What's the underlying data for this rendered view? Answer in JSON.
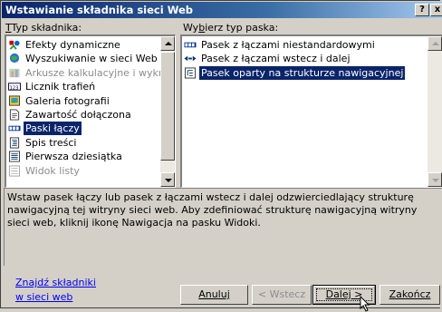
{
  "window": {
    "title": "Wstawianie składnika sieci Web",
    "help_btn": "?",
    "close_btn": "x"
  },
  "left_panel": {
    "label": "Typ składnika:",
    "items": [
      {
        "label": "Efekty dynamiczne",
        "icon": "dynamic-effects-icon",
        "state": "normal"
      },
      {
        "label": "Wyszukiwanie w sieci Web",
        "icon": "web-search-icon",
        "state": "normal"
      },
      {
        "label": "Arkusze kalkulacyjne i wykresy",
        "icon": "spreadsheet-icon",
        "state": "disabled"
      },
      {
        "label": "Licznik trafień",
        "icon": "hit-counter-icon",
        "state": "normal"
      },
      {
        "label": "Galeria fotografii",
        "icon": "photo-gallery-icon",
        "state": "normal"
      },
      {
        "label": "Zawartość dołączona",
        "icon": "included-content-icon",
        "state": "normal"
      },
      {
        "label": "Paski łączy",
        "icon": "link-bar-icon",
        "state": "selected"
      },
      {
        "label": "Spis treści",
        "icon": "table-of-contents-icon",
        "state": "normal"
      },
      {
        "label": "Pierwsza dziesiątka",
        "icon": "top-ten-icon",
        "state": "normal"
      },
      {
        "label": "Widok listy",
        "icon": "list-view-icon",
        "state": "disabled"
      }
    ]
  },
  "right_panel": {
    "label": "Wybierz typ paska:",
    "items": [
      {
        "label": "Pasek z łączami niestandardowymi",
        "icon": "custom-links-bar-icon",
        "state": "normal"
      },
      {
        "label": "Pasek z łączami wstecz i dalej",
        "icon": "back-next-bar-icon",
        "state": "normal"
      },
      {
        "label": "Pasek oparty na strukturze nawigacyjnej",
        "icon": "navigation-structure-bar-icon",
        "state": "selected"
      }
    ]
  },
  "description": "Wstaw pasek łączy lub pasek z łączami wstecz i dalej odzwierciedlający strukturę nawigacyjną tej witryny sieci web. Aby zdefiniować strukturę nawigacyjną witryny sieci web, kliknij ikonę Nawigacja na pasku Widoki.",
  "find_link": {
    "line1": "Znajdź składniki",
    "line2": "w sieci web"
  },
  "buttons": {
    "cancel": "Anuluj",
    "back": "< Wstecz",
    "next": "Dalej >",
    "finish": "Zakończ"
  },
  "colors": {
    "titlebar_start": "#0a246a",
    "titlebar_end": "#a6caf0",
    "selection": "#0a246a",
    "link": "#0000ee"
  }
}
